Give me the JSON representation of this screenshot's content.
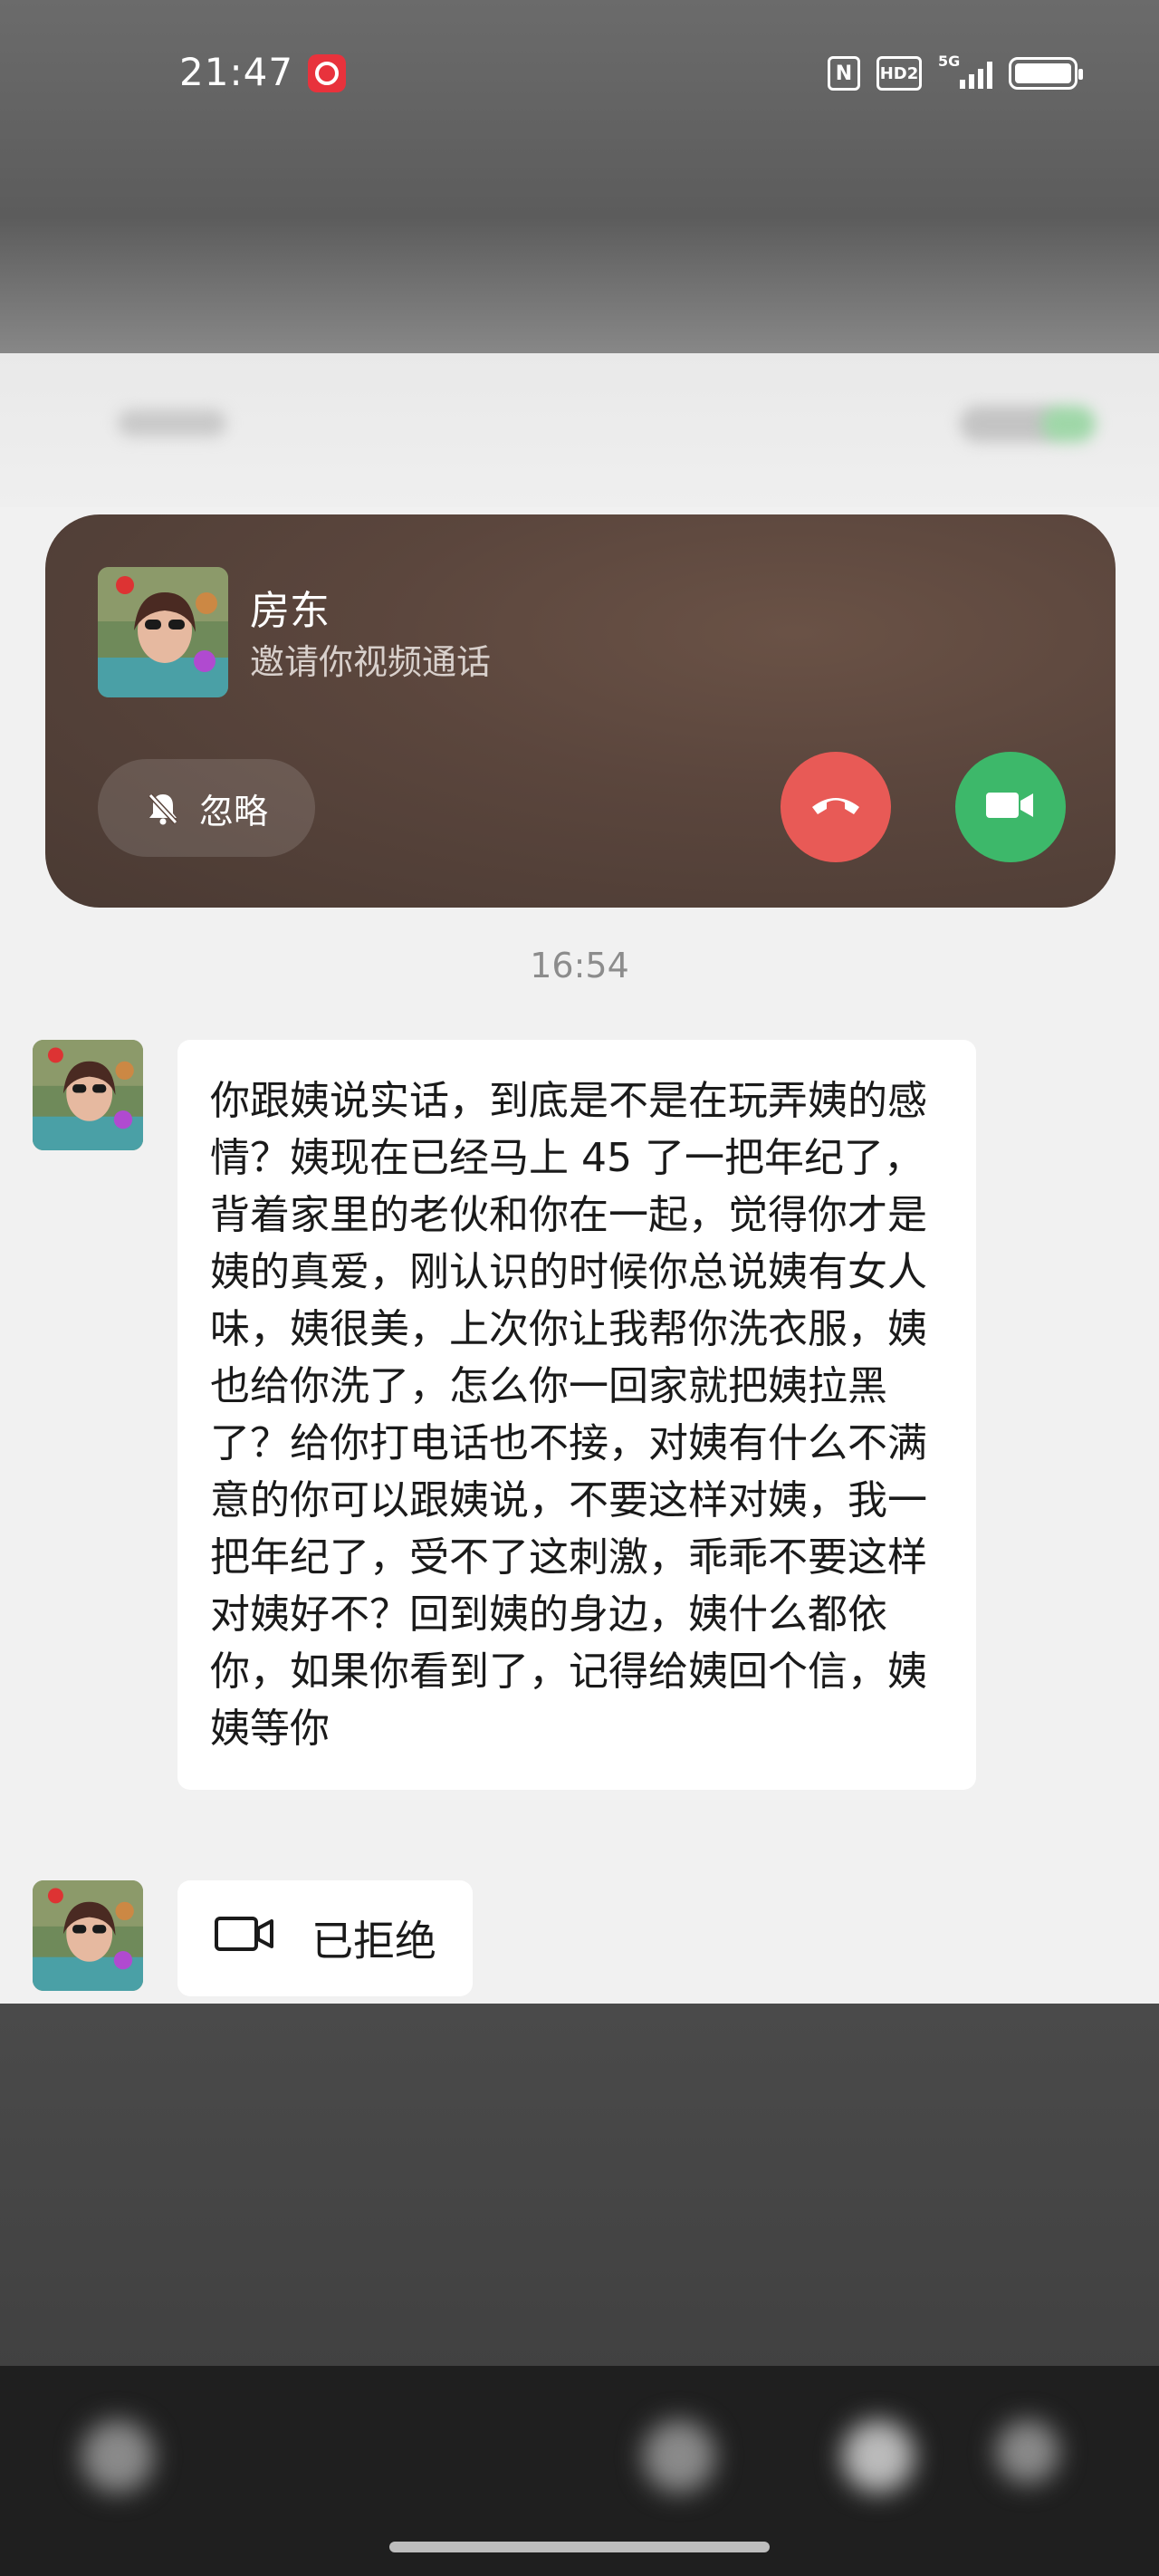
{
  "status_bar": {
    "time": "21:47",
    "nfc_label": "N",
    "hd_label": "HD2",
    "network_label": "5G"
  },
  "call_banner": {
    "caller_name": "房东",
    "caller_subtitle": "邀请你视频通话",
    "ignore_label": "忽略"
  },
  "chat": {
    "timestamp": "16:54",
    "messages": [
      {
        "text": "你跟姨说实话，到底是不是在玩弄姨的感情？姨现在已经马上 45 了一把年纪了，背着家里的老伙和你在一起，觉得你才是姨的真爱，刚认识的时候你总说姨有女人味，姨很美，上次你让我帮你洗衣服，姨也给你洗了，怎么你一回家就把姨拉黑了？给你打电话也不接，对姨有什么不满意的你可以跟姨说，不要这样对姨，我一把年纪了，受不了这刺激，乖乖不要这样对姨好不？回到姨的身边，姨什么都依你，如果你看到了，记得给姨回个信，姨姨等你"
      },
      {
        "call_status": "已拒绝"
      }
    ]
  },
  "colors": {
    "decline": "#e85a56",
    "accept": "#3db86a",
    "banner_bg": "#5b463d",
    "chat_bg": "#f1f1f1"
  },
  "icons": {
    "ignore": "bell-off-icon",
    "decline": "hang-up-icon",
    "accept": "video-camera-icon",
    "call_record": "video-camera-outline-icon"
  }
}
